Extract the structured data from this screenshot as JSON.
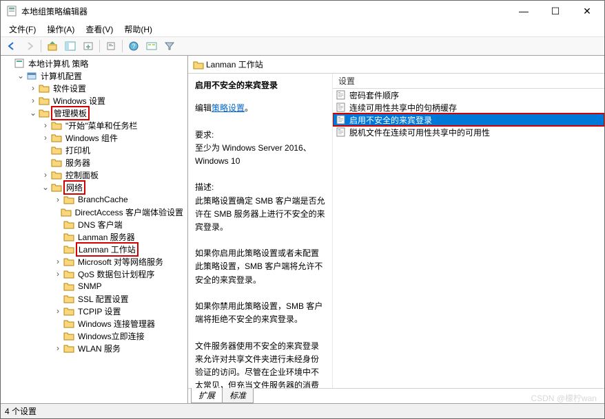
{
  "window": {
    "title": "本地组策略编辑器",
    "controls": {
      "min": "—",
      "max": "☐",
      "close": "✕"
    }
  },
  "menu": {
    "file": "文件(F)",
    "action": "操作(A)",
    "view": "查看(V)",
    "help": "帮助(H)"
  },
  "tree": {
    "root": "本地计算机 策略",
    "computer_config": "计算机配置",
    "software_settings": "软件设置",
    "windows_settings": "Windows 设置",
    "admin_templates": "管理模板",
    "start_menu": "\"开始\"菜单和任务栏",
    "windows_components": "Windows 组件",
    "printers": "打印机",
    "server": "服务器",
    "control_panel": "控制面板",
    "network": "网络",
    "branch_cache": "BranchCache",
    "direct_access": "DirectAccess 客户端体验设置",
    "dns_client": "DNS 客户端",
    "lanman_server": "Lanman 服务器",
    "lanman_workstation": "Lanman 工作站",
    "microsoft_peer": "Microsoft 对等网络服务",
    "qos": "QoS 数据包计划程序",
    "snmp": "SNMP",
    "ssl": "SSL 配置设置",
    "tcpip": "TCPIP 设置",
    "win_conn_mgr": "Windows 连接管理器",
    "win_instant": "Windows立即连接",
    "wlan": "WLAN 服务"
  },
  "path_header": "Lanman 工作站",
  "description": {
    "title": "启用不安全的来宾登录",
    "edit_prefix": "编辑",
    "edit_link": "策略设置",
    "req_label": "要求:",
    "req_text": "至少为 Windows Server 2016、Windows 10",
    "desc_label": "描述:",
    "p1": "此策略设置确定 SMB 客户端是否允许在 SMB 服务器上进行不安全的来宾登录。",
    "p2": "如果你启用此策略设置或者未配置此策略设置，SMB 客户端将允许不安全的来宾登录。",
    "p3": "如果你禁用此策略设置，SMB 客户端将拒绝不安全的来宾登录。",
    "p4": "文件服务器使用不安全的来宾登录来允许对共享文件夹进行未经身份验证的访问。尽管在企业环境中不太常见，但充当文件服务器的消费型网络附加存储(NAS)设备经常使用不安全的来宾登录。默认情况"
  },
  "settings": {
    "header": "设置",
    "items": [
      "密码套件顺序",
      "连续可用性共享中的句柄缓存",
      "启用不安全的来宾登录",
      "脱机文件在连续可用性共享中的可用性"
    ],
    "selected_index": 2
  },
  "tabs": {
    "ext": "扩展",
    "std": "标准"
  },
  "status": "4 个设置",
  "watermark": "CSDN @檬柠wan"
}
